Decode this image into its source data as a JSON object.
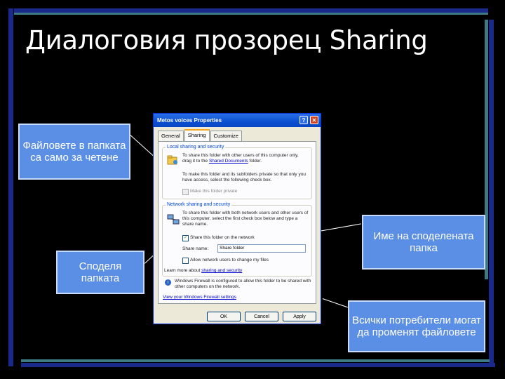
{
  "slide": {
    "title": "Диалоговия прозорец Sharing"
  },
  "callouts": {
    "read_only": "Файловете в папката са само за четене",
    "share_folder": "Споделя папката",
    "share_name": "Име на споделената папка",
    "all_users": "Всички потребители могат да променят файловете"
  },
  "dialog": {
    "title": "Metos voices Properties",
    "help_btn": "?",
    "close_btn": "✕",
    "tabs": [
      "General",
      "Sharing",
      "Customize"
    ],
    "local": {
      "label": "Local sharing and security",
      "text1": "To share this folder with other users of this computer only, drag it to the",
      "text1_link": "Shared Documents",
      "text1_end": "folder.",
      "text2": "To make this folder and its subfolders private so that only you have access, select the following check box.",
      "checkbox_private": "Make this folder private"
    },
    "network": {
      "label": "Network sharing and security",
      "text": "To share this folder with both network users and other users of this computer, select the first check box below and type a share name.",
      "checkbox_share": "Share this folder on the network",
      "share_name_label": "Share name:",
      "share_name_value": "Share folder",
      "checkbox_allow": "Allow network users to change my files",
      "learn_more": "Learn more about",
      "learn_more_link": "sharing and security"
    },
    "firewall": {
      "text": "Windows Firewall is configured to allow this folder to be shared with other computers on the network.",
      "link": "View your Windows Firewall settings"
    },
    "buttons": {
      "ok": "OK",
      "cancel": "Cancel",
      "apply": "Apply"
    }
  },
  "colors": {
    "callout_fill": "#5b8fe6",
    "bar_blue": "#1a2a8a",
    "bar_teal": "#3d7a84"
  }
}
